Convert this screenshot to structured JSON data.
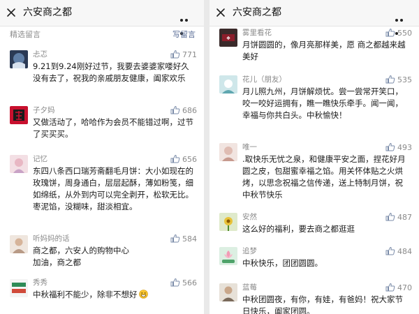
{
  "left_panel": {
    "title": "六安商之都",
    "section_label": "精选留言",
    "write_label": "写留言",
    "comments": [
      {
        "name": "忐忑",
        "likes": "771",
        "text": "9.21到9.24刚好过节，我要去婆婆家喽好久没有去了，祝我的亲戚朋友健康，阖家欢乐"
      },
      {
        "name": "子夕妈",
        "likes": "686",
        "text": "又做活动了，哈哈作为会员不能错过啊，过节了买买买。"
      },
      {
        "name": "记忆",
        "likes": "656",
        "text": "东四八条西口瑞芳斋翻毛月饼：大小如现在的玫瑰饼，周身通白，层层起酥，薄如粉笺，细如绵纸，从外到内可以完全剥开，松软无比。枣泥馅，没糊味，甜淡相宜。"
      },
      {
        "name": "听妈妈的话",
        "likes": "584",
        "text": "商之都，六安人的购物中心\n加油，商之都"
      },
      {
        "name": "秀秀",
        "likes": "566",
        "text": "中秋福利不能少，除非不想好"
      }
    ]
  },
  "right_panel": {
    "title": "六安商之都",
    "comments": [
      {
        "name": "雾里看花",
        "likes": "550",
        "text": "月饼圆圆的，像月亮那样美，愿 商之都越来越美好"
      },
      {
        "name": "花儿（朋友）",
        "likes": "535",
        "text": "月儿照九州，月饼解烦忧。尝一尝常开笑口，咬一咬好运拥有，瞧一瞧快乐牵手。闻一闻，幸福与你共白头。中秋愉快！"
      },
      {
        "name": "唯一",
        "likes": "493",
        "text": ".取快乐无忧之泉，和健康平安之面，捏花好月圆之皮，包甜蜜幸福之馅。用关怀体贴之火烘烤，以思念祝福之信传递，送上特制月饼，祝中秋节快乐"
      },
      {
        "name": "安然",
        "likes": "487",
        "text": "这么好的福利，要去商之都逛逛"
      },
      {
        "name": "追梦",
        "likes": "484",
        "text": "中秋快乐，团团圆圆。"
      },
      {
        "name": "蓝莓",
        "likes": "470",
        "text": "中秋团圆夜，有你，有娃，有爸妈！祝大家节日快乐，阖家团圆。"
      }
    ]
  },
  "colors": {
    "link": "#576b95",
    "meta": "#8a8a8a",
    "text": "#1a1a1a",
    "topbar": "#f7f7f7"
  }
}
